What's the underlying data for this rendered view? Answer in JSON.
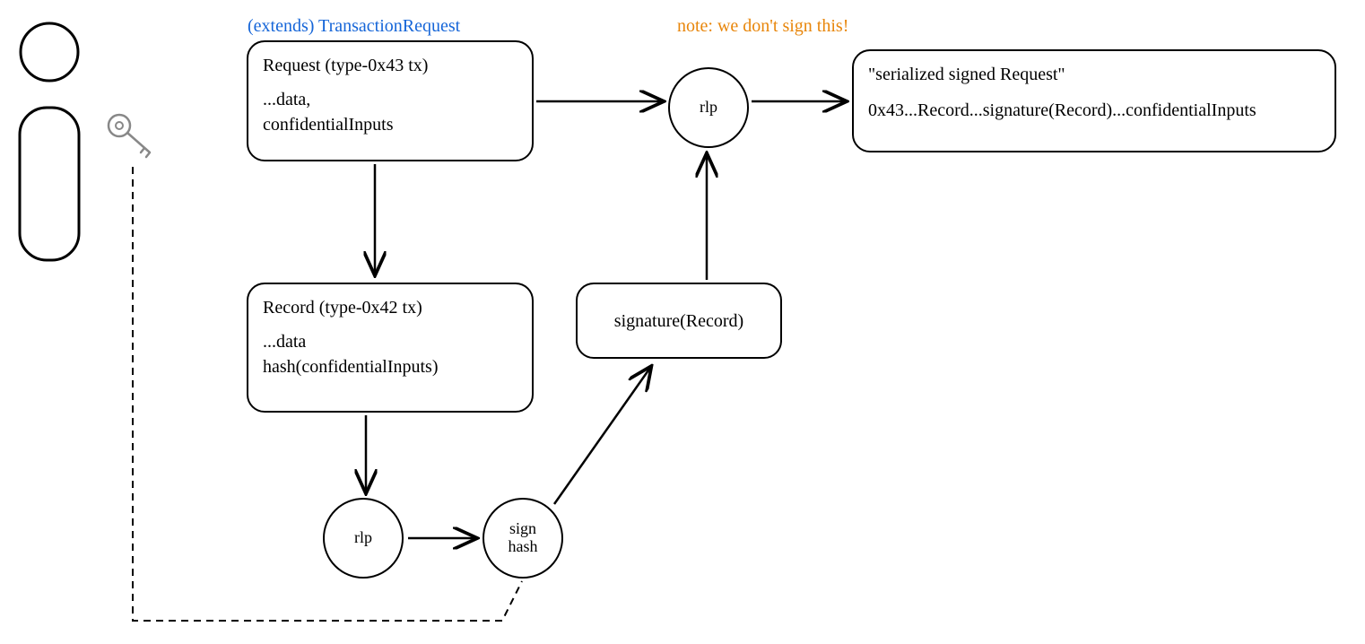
{
  "labels": {
    "extends": "(extends) TransactionRequest",
    "note": "note: we don't sign this!"
  },
  "nodes": {
    "request": {
      "title": "Request (type-0x43 tx)",
      "lines": "...data,\nconfidentialInputs"
    },
    "record": {
      "title": "Record (type-0x42 tx)",
      "lines": "...data\nhash(confidentialInputs)"
    },
    "signature": {
      "text": "signature(Record)"
    },
    "result": {
      "title": "\"serialized signed Request\"",
      "lines": "0x43...Record...signature(Record)...confidentialInputs"
    },
    "rlp1": "rlp",
    "rlp2": "rlp",
    "signhash": "sign\nhash"
  },
  "icons": {
    "user": "user-icon",
    "key": "key-icon"
  }
}
